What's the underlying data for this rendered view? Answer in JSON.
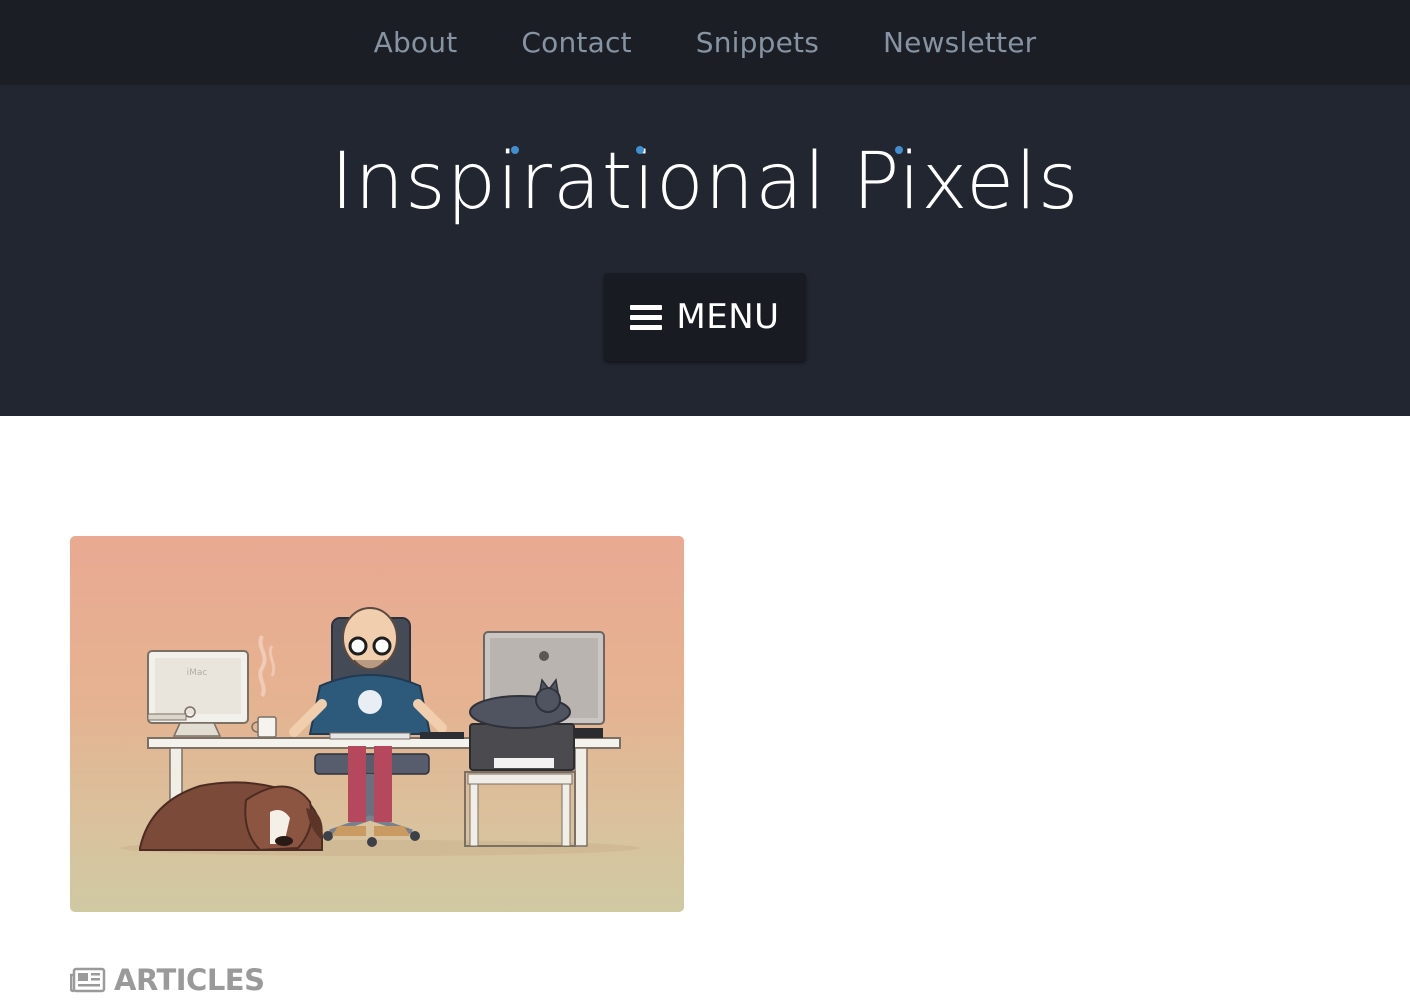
{
  "top_nav": {
    "items": [
      {
        "label": "About"
      },
      {
        "label": "Contact"
      },
      {
        "label": "Snippets"
      },
      {
        "label": "Newsletter"
      }
    ]
  },
  "header": {
    "site_title": "Inspirational Pixels",
    "accent_color": "#3f8fd0",
    "menu_button": {
      "label": "MENU",
      "icon": "hamburger-icon"
    }
  },
  "feature": {
    "image_caption_text": "iMac"
  },
  "section": {
    "icon": "newspaper-icon",
    "label": "ARTICLES"
  }
}
